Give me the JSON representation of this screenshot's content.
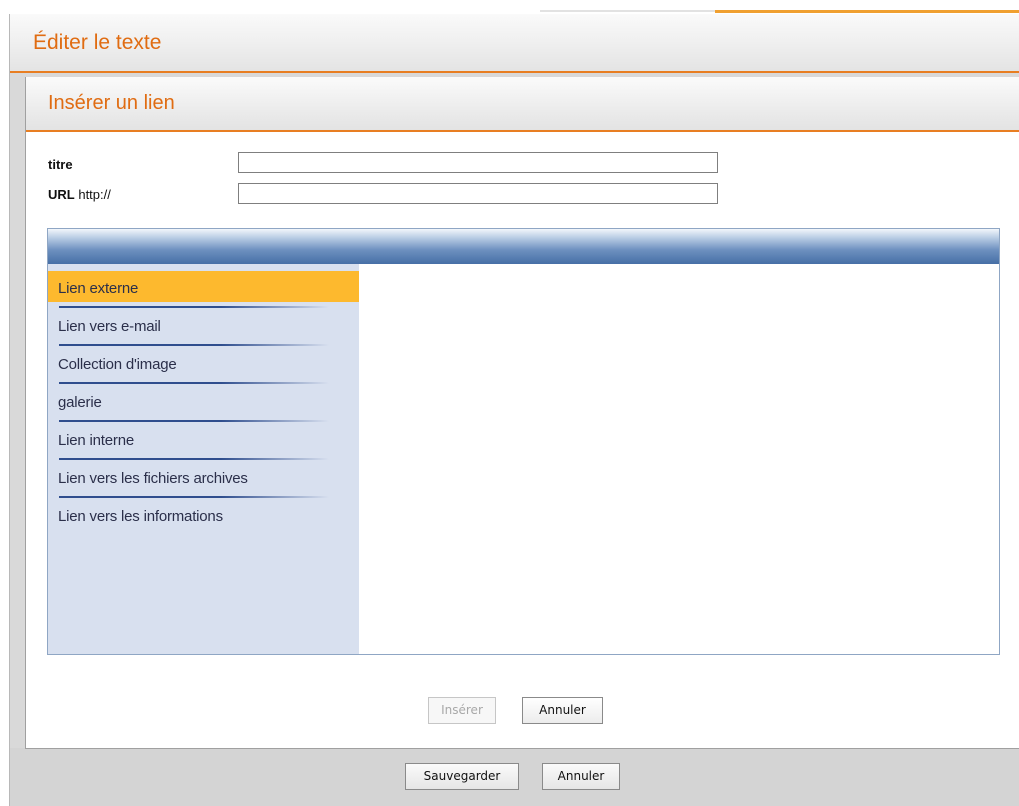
{
  "outer_dialog": {
    "title": "Éditer le texte",
    "save_label": "Sauvegarder",
    "cancel_label": "Annuler"
  },
  "insert_link_dialog": {
    "title": "Insérer un lien",
    "title_field": {
      "label": "titre",
      "value": ""
    },
    "url_field": {
      "label": "URL",
      "prefix": "http://",
      "value": ""
    },
    "link_types": [
      {
        "label": "Lien externe",
        "selected": true
      },
      {
        "label": "Lien vers e-mail",
        "selected": false
      },
      {
        "label": "Collection d'image",
        "selected": false
      },
      {
        "label": "galerie",
        "selected": false
      },
      {
        "label": "Lien interne",
        "selected": false
      },
      {
        "label": "Lien vers les fichiers archives",
        "selected": false
      },
      {
        "label": "Lien vers les informations",
        "selected": false
      }
    ],
    "insert_label": "Insérer",
    "insert_enabled": false,
    "cancel_label": "Annuler"
  },
  "colors": {
    "accent_orange": "#e06c12",
    "selected_item": "#fdb92e",
    "sidebar_bg": "#d8e0ef",
    "panel_bar": "#466fa6"
  }
}
